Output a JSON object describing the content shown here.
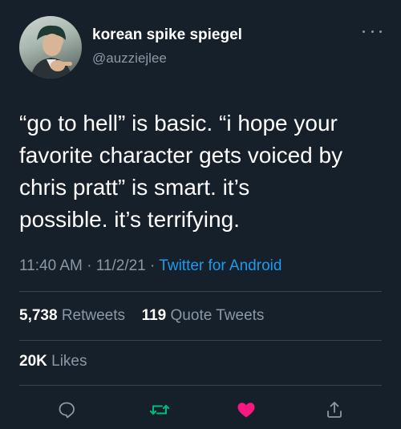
{
  "user": {
    "display_name": "korean spike spiegel",
    "handle": "@auzziejlee"
  },
  "tweet": {
    "lines": [
      "“go to hell” is basic. “i hope your",
      "favorite character gets voiced by",
      "chris pratt” is smart. it’s",
      "possible. it’s terrifying."
    ],
    "time": "11:40 AM",
    "date": "11/2/21",
    "source": "Twitter for Android",
    "separator": "·"
  },
  "stats": {
    "retweets_count": "5,738",
    "retweets_label": "Retweets",
    "quotes_count": "119",
    "quotes_label": "Quote Tweets",
    "likes_count": "20K",
    "likes_label": "Likes"
  },
  "actions": {
    "reply_icon": "reply-icon",
    "retweet_icon": "retweet-icon",
    "like_icon": "like-icon",
    "share_icon": "share-icon"
  },
  "colors": {
    "background": "#15202b",
    "secondary_text": "#8b98a5",
    "link": "#1d9bf0",
    "retweet_green": "#00ba7c",
    "like_pink": "#f91880",
    "divider": "#38444d"
  }
}
